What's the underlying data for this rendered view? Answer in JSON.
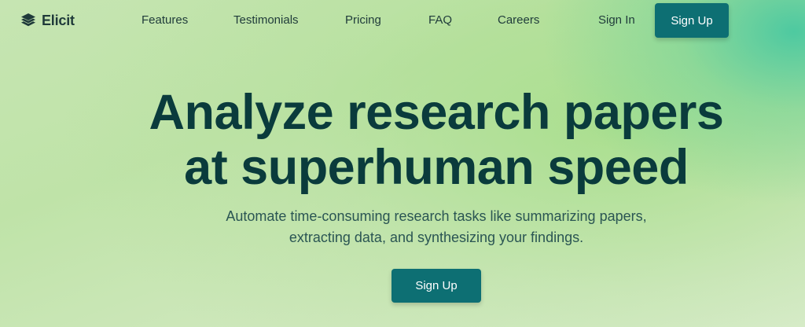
{
  "brand": {
    "name": "Elicit",
    "logo_icon": "stacked-layers-icon"
  },
  "nav": {
    "links": [
      "Features",
      "Testimonials",
      "Pricing",
      "FAQ",
      "Careers"
    ],
    "sign_in": "Sign In",
    "sign_up": "Sign Up"
  },
  "hero": {
    "title_line1": "Analyze research papers",
    "title_line2": "at superhuman speed",
    "subtitle_line1": "Automate time-consuming research tasks like summarizing papers,",
    "subtitle_line2": "extracting data, and synthesizing your findings.",
    "cta": "Sign Up"
  },
  "colors": {
    "primary_button": "#0d6f73",
    "heading": "#0a3b3c",
    "background_start": "#c6e5b2",
    "background_accent": "#48c8a0"
  }
}
